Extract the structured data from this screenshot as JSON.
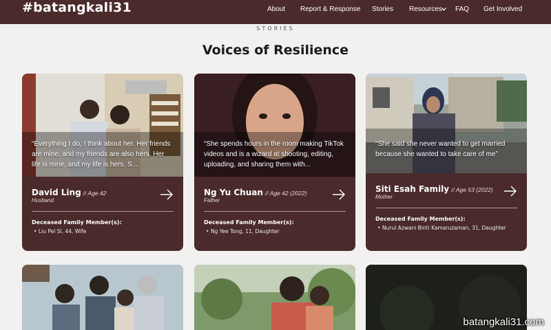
{
  "site": {
    "logo": "#batangkali31"
  },
  "nav": {
    "items": [
      "About",
      "Report & Response",
      "Stories",
      "Resources",
      "FAQ",
      "Get Involved"
    ]
  },
  "section": {
    "label": "STORIES",
    "title": "Voices of Resilience"
  },
  "cards": [
    {
      "quote": "“Everything I do, I think about her. Her friends are mine, and my friends are also hers. Her life is mine, and my life is hers. S...",
      "name": "David Ling",
      "age": "// Age 42",
      "relation": "Husband",
      "deceased_label": "Deceased Family Member(s):",
      "deceased": [
        "Liu Pei Si, 44, Wife"
      ]
    },
    {
      "quote": "“She spends hours in the room making TikTok videos and is a wizard at shooting, editing, uploading, and sharing them with...",
      "name": "Ng Yu Chuan",
      "age": "// Age 42 (2022)",
      "relation": "Father",
      "deceased_label": "Deceased Family Member(s):",
      "deceased": [
        "Ng Yee Tong, 11, Daughter"
      ]
    },
    {
      "quote": "“She said she never wanted to get married because she wanted to take care of me”",
      "name": "Siti Esah Family",
      "age": "// Age 53 (2022)",
      "relation": "Mother",
      "deceased_label": "Deceased Family Member(s):",
      "deceased": [
        "Nurul Azwani Binti Kamaruzaman, 31, Daughter"
      ]
    }
  ],
  "watermark": "batangkali31.com",
  "colors": {
    "brand": "#4a2a2b",
    "background": "#f2f1f0"
  },
  "icons": {
    "dropdown": "chevron-down-icon",
    "card_link": "arrow-right-icon"
  }
}
